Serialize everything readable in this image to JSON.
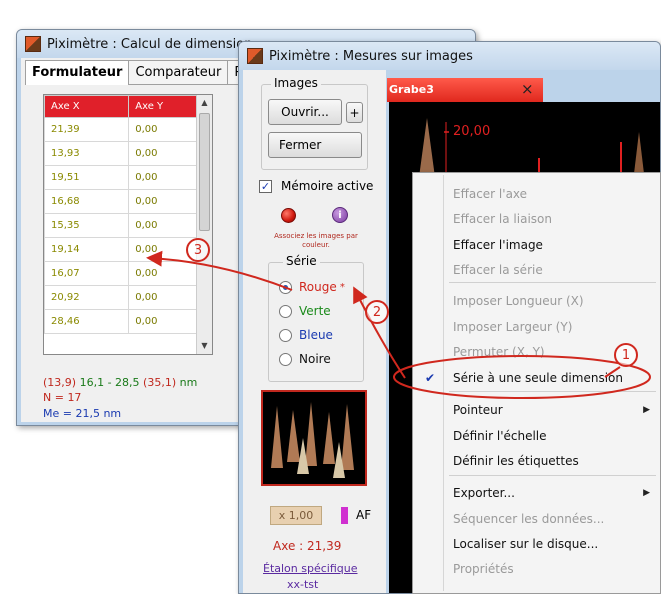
{
  "left_window": {
    "title": "Piximètre : Calcul de dimension",
    "tabs": [
      "Formulateur",
      "Comparateur",
      "Par"
    ],
    "columns": [
      "Axe X",
      "Axe Y"
    ],
    "rows": [
      [
        "21,39",
        "0,00"
      ],
      [
        "13,93",
        "0,00"
      ],
      [
        "19,51",
        "0,00"
      ],
      [
        "16,68",
        "0,00"
      ],
      [
        "15,35",
        "0,00"
      ],
      [
        "19,14",
        "0,00"
      ],
      [
        "16,07",
        "0,00"
      ],
      [
        "20,92",
        "0,00"
      ],
      [
        "28,46",
        "0,00"
      ]
    ],
    "stats": {
      "line1_a": "(13,9)",
      "line1_b": " 16,1 - 28,5 ",
      "line1_c": "(35,1)",
      "line1_d": " nm",
      "n": "N = 17",
      "me": "Me = 21,5 nm"
    }
  },
  "right_window": {
    "title": "Piximètre : Mesures sur images",
    "images_group": "Images",
    "open_button": "Ouvrir...",
    "plus_button": "+",
    "close_button": "Fermer",
    "memory_checkbox": "Mémoire active",
    "memory_checked": true,
    "associate_text": "Associez les images par couleur.",
    "series_group": "Série",
    "series": [
      {
        "label": "Rouge",
        "color": "#d0281e",
        "selected": true
      },
      {
        "label": "Verte",
        "color": "#1a8a1a",
        "selected": false
      },
      {
        "label": "Bleue",
        "color": "#1a3ab0",
        "selected": false
      },
      {
        "label": "Noire",
        "color": "#111111",
        "selected": false
      }
    ],
    "zoom_value": "x 1,00",
    "af_label": "AF",
    "axe_value": "Axe :  21,39",
    "etalon_link": "Étalon spécifique",
    "etalon_value": "xx-tst",
    "image_tab": "Grabe3",
    "image_tab_close": "×",
    "measure_label": "20,00"
  },
  "context_menu": {
    "items": [
      {
        "label": "Effacer l'axe",
        "disabled": true
      },
      {
        "label": "Effacer la liaison",
        "disabled": true
      },
      {
        "label": "Effacer l'image",
        "disabled": false
      },
      {
        "label": "Effacer la série",
        "disabled": true
      },
      {
        "label": "Imposer Longueur  (X)",
        "disabled": true
      },
      {
        "label": "Imposer Largeur  (Y)",
        "disabled": true
      },
      {
        "label": "Permuter (X, Y)",
        "disabled": true
      },
      {
        "label": "Série à une seule dimension",
        "disabled": false,
        "checked": true
      },
      {
        "label": "Pointeur",
        "disabled": false,
        "submenu": true
      },
      {
        "label": "Définir l'échelle",
        "disabled": false
      },
      {
        "label": "Définir les étiquettes",
        "disabled": false
      },
      {
        "label": "Exporter...",
        "disabled": false,
        "submenu": true
      },
      {
        "label": "Séquencer les données...",
        "disabled": true
      },
      {
        "label": "Localiser sur le disque...",
        "disabled": false
      },
      {
        "label": "Propriétés",
        "disabled": true
      }
    ]
  },
  "annotations": [
    "1",
    "2",
    "3"
  ],
  "colors": {
    "accent_red": "#d0281e",
    "header_red": "#e0202a"
  }
}
